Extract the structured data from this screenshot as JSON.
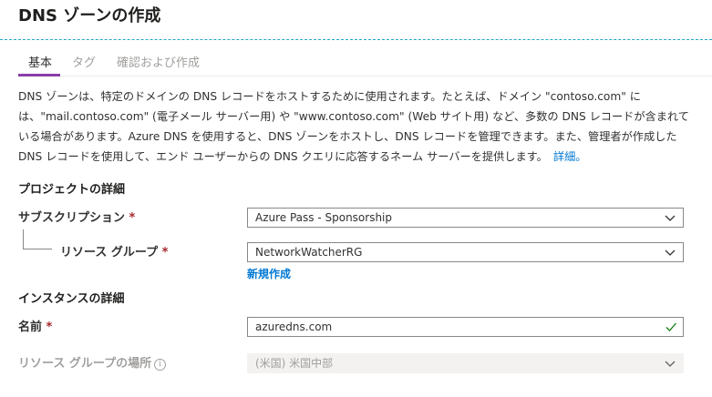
{
  "page": {
    "title": "DNS ゾーンの作成"
  },
  "tabs": [
    {
      "label": "基本",
      "active": true
    },
    {
      "label": "タグ",
      "active": false
    },
    {
      "label": "確認および作成",
      "active": false
    }
  ],
  "description": {
    "text": "DNS ゾーンは、特定のドメインの DNS レコードをホストするために使用されます。たとえば、ドメイン \"contoso.com\" には、\"mail.contoso.com\" (電子メール サーバー用) や \"www.contoso.com\" (Web サイト用) など、多数の DNS レコードが含まれている場合があります。Azure DNS を使用すると、DNS ゾーンをホストし、DNS レコードを管理できます。また、管理者が作成した DNS レコードを使用して、エンド ユーザーからの DNS クエリに応答するネーム サーバーを提供します。",
    "link": "詳細。"
  },
  "project": {
    "heading": "プロジェクトの詳細",
    "subscription_label": "サブスクリプション",
    "subscription_value": "Azure Pass - Sponsorship",
    "rg_label": "リソース グループ",
    "rg_value": "NetworkWatcherRG",
    "create_new": "新規作成"
  },
  "instance": {
    "heading": "インスタンスの詳細",
    "name_label": "名前",
    "name_value": "azuredns.com",
    "location_label": "リソース グループの場所",
    "location_value": "(米国) 米国中部"
  },
  "required_marker": "*",
  "info_glyph": "i",
  "colors": {
    "accent": "#8a3ea8",
    "link": "#0078d4",
    "required": "#a4262c",
    "valid": "#107c10",
    "dash": "#23a6c8"
  },
  "icons": {
    "chevron": "chevron-down-icon",
    "check": "checkmark-icon",
    "info": "info-icon"
  }
}
